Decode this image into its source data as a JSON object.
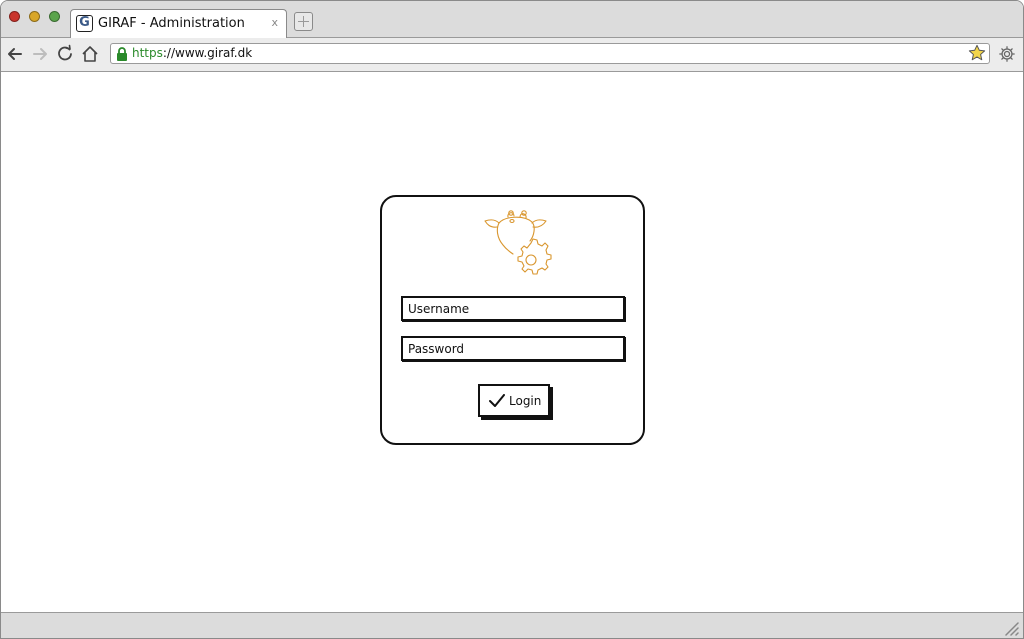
{
  "browser": {
    "tab_title": "GIRAF - Administration",
    "tab_close": "x",
    "favicon_letter": "G",
    "url_scheme": "https",
    "url_rest": "://www.giraf.dk"
  },
  "icons": {
    "back": "arrow-left-icon",
    "forward": "arrow-right-icon",
    "reload": "reload-icon",
    "home": "home-icon",
    "lock": "lock-icon",
    "bookmark": "star-icon",
    "settings": "gear-icon",
    "logo": "giraf-giraffe-gear-logo",
    "check": "checkmark-icon"
  },
  "colors": {
    "logo": "#d9962e",
    "secure": "#2a8a2a"
  },
  "login": {
    "username_placeholder": "Username",
    "password_placeholder": "Password",
    "button_label": "Login"
  }
}
